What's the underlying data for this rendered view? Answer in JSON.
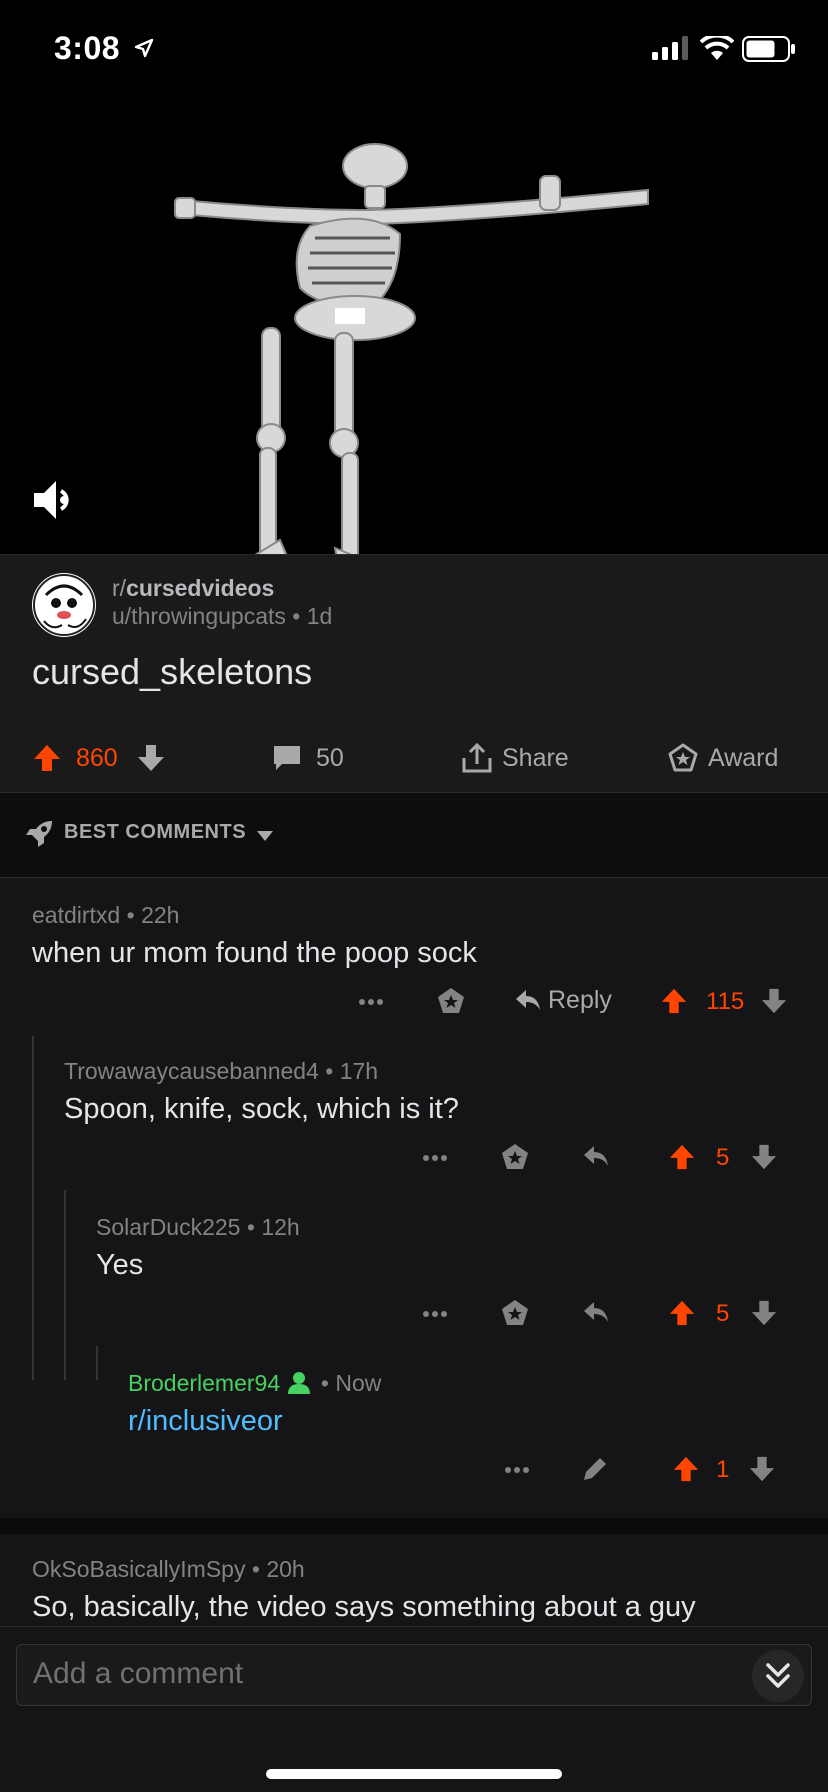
{
  "status_bar": {
    "time": "3:08"
  },
  "post": {
    "subreddit_prefix": "r/",
    "subreddit": "cursedvideos",
    "author": "u/throwingupcats",
    "age": "1d",
    "title": "cursed_skeletons",
    "score": "860",
    "comment_count": "50",
    "share_label": "Share",
    "award_label": "Award"
  },
  "sort": {
    "label": "BEST COMMENTS"
  },
  "comments": [
    {
      "author": "eatdirtxd",
      "age": "22h",
      "body": "when ur mom found the poop sock",
      "reply_label": "Reply",
      "score": "115"
    },
    {
      "author": "Trowawaycausebanned4",
      "age": "17h",
      "body": "Spoon, knife, sock, which is it?",
      "score": "5"
    },
    {
      "author": "SolarDuck225",
      "age": "12h",
      "body": "Yes",
      "score": "5"
    },
    {
      "author": "Broderlemer94",
      "age": "Now",
      "body": "r/inclusiveor",
      "score": "1"
    },
    {
      "author": "OkSoBasicallyImSpy",
      "age": "20h",
      "body": "So, basically, the video says something about a guy"
    }
  ],
  "composer": {
    "placeholder": "Add a comment"
  },
  "colors": {
    "upvote": "#ff4500",
    "background": "#151517",
    "link": "#4fbcff",
    "op_user": "#46d160"
  }
}
